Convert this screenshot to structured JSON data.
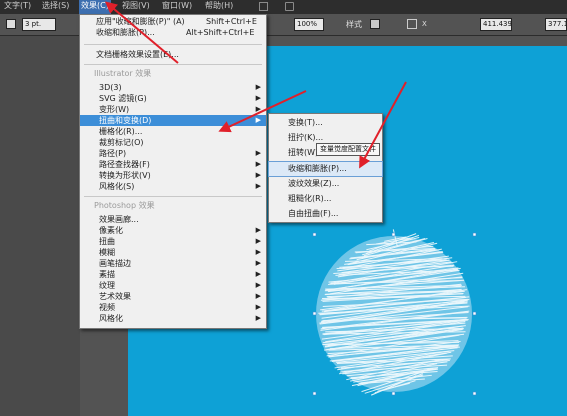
{
  "menubar": {
    "items": [
      "文字(T)",
      "选择(S)",
      "效果(C)",
      "视图(V)",
      "窗口(W)",
      "帮助(H)"
    ]
  },
  "controlbar": {
    "stroke_weight": "3 pt.",
    "zoom": "100%",
    "style_label": "样式",
    "x_value": "411.439",
    "y_value": "377.1"
  },
  "effect_menu": {
    "top_items": [
      {
        "label": "应用\"收缩和膨胀(P)\" (A)",
        "shortcut": "Shift+Ctrl+E"
      },
      {
        "label": "收缩和膨胀(P)...",
        "shortcut": "Alt+Shift+Ctrl+E"
      }
    ],
    "doc_raster": "文档栅格效果设置(E)...",
    "illustrator_section": "Illustrator 效果",
    "illustrator_items": [
      {
        "label": "3D(3)",
        "has_sub": true
      },
      {
        "label": "SVG 滤镜(G)",
        "has_sub": true
      },
      {
        "label": "变形(W)",
        "has_sub": true
      },
      {
        "label": "扭曲和变换(D)",
        "has_sub": true,
        "highlighted": true
      },
      {
        "label": "栅格化(R)...",
        "has_sub": false
      },
      {
        "label": "裁剪标记(O)",
        "has_sub": false
      },
      {
        "label": "路径(P)",
        "has_sub": true
      },
      {
        "label": "路径查找器(F)",
        "has_sub": true
      },
      {
        "label": "转换为形状(V)",
        "has_sub": true
      },
      {
        "label": "风格化(S)",
        "has_sub": true
      }
    ],
    "photoshop_section": "Photoshop 效果",
    "photoshop_items": [
      {
        "label": "效果画廊...",
        "has_sub": false
      },
      {
        "label": "像素化",
        "has_sub": true
      },
      {
        "label": "扭曲",
        "has_sub": true
      },
      {
        "label": "模糊",
        "has_sub": true
      },
      {
        "label": "画笔描边",
        "has_sub": true
      },
      {
        "label": "素描",
        "has_sub": true
      },
      {
        "label": "纹理",
        "has_sub": true
      },
      {
        "label": "艺术效果",
        "has_sub": true
      },
      {
        "label": "视频",
        "has_sub": true
      },
      {
        "label": "风格化",
        "has_sub": true
      }
    ]
  },
  "distort_submenu": {
    "items": [
      {
        "label": "变换(T)..."
      },
      {
        "label": "扭拧(K)..."
      },
      {
        "label": "扭转(W)..."
      },
      {
        "label": "收缩和膨胀(P)...",
        "highlighted": true
      },
      {
        "label": "波纹效果(Z)..."
      },
      {
        "label": "粗糙化(R)..."
      },
      {
        "label": "自由扭曲(F)..."
      }
    ],
    "tooltip": "变量觉度配置文件"
  },
  "colors": {
    "artboard": "#0ea1d6",
    "menu_highlight": "#3c8ed8",
    "annotation_arrow": "#e0202a",
    "scribble": "#ffffff"
  }
}
